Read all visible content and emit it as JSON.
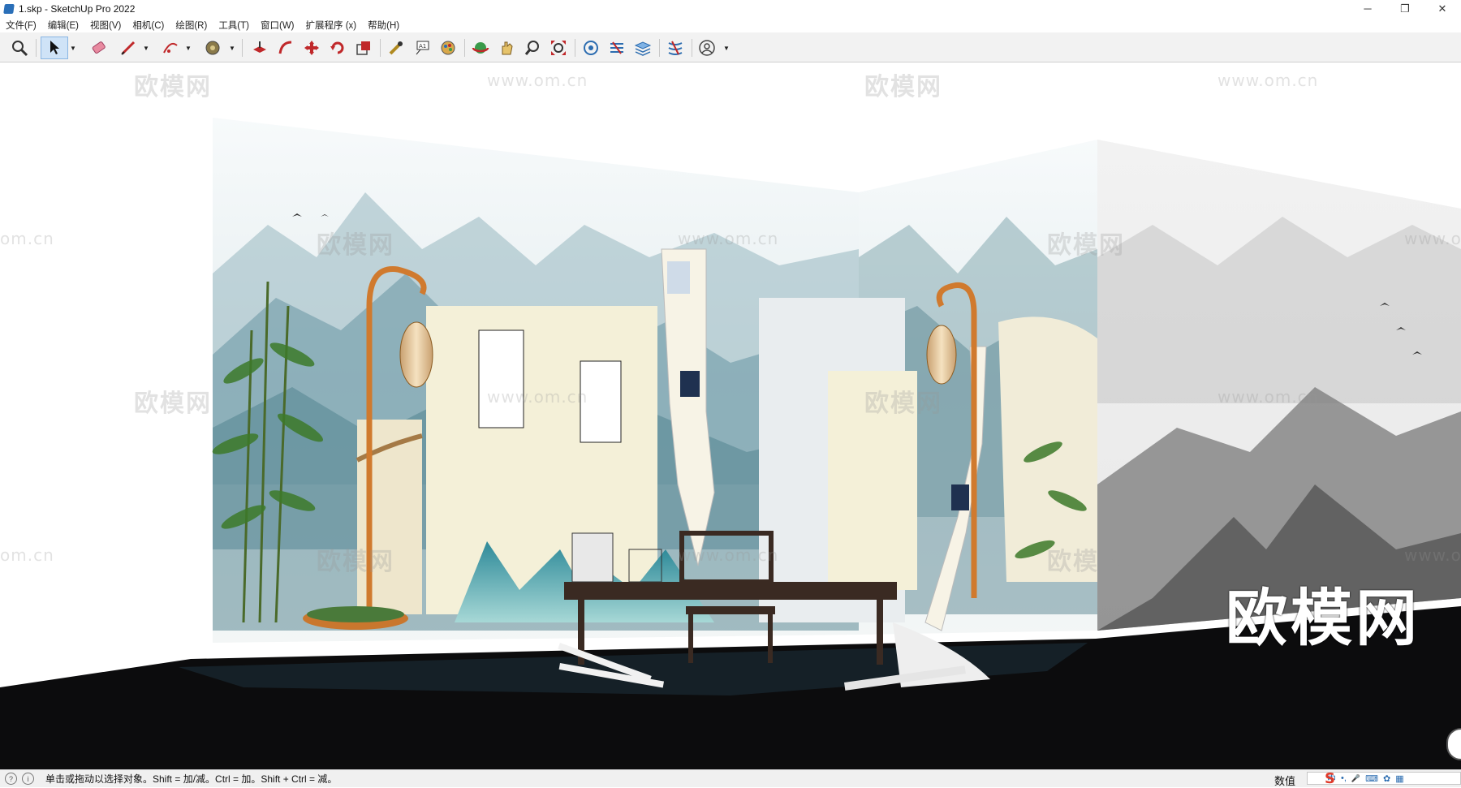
{
  "window": {
    "title": "1.skp - SketchUp Pro 2022",
    "minimize": "─",
    "restore": "❐",
    "close": "✕"
  },
  "menu": [
    "文件(F)",
    "编辑(E)",
    "视图(V)",
    "相机(C)",
    "绘图(R)",
    "工具(T)",
    "窗口(W)",
    "扩展程序 (x)",
    "帮助(H)"
  ],
  "toolbar": {
    "tools": [
      "zoom-icon",
      "select-icon",
      "eraser-icon",
      "pencil-line-icon",
      "arc-icon",
      "paint-bucket-icon",
      "push-pull-icon",
      "follow-me-icon",
      "move-icon",
      "rotate-icon",
      "scale-icon",
      "tape-measure-icon",
      "text-icon",
      "paint-icon",
      "orbit-icon",
      "pan-icon",
      "zoom-window-icon",
      "zoom-extents-icon",
      "warehouse-icon",
      "extension-icon",
      "layers-icon",
      "sandbox-icon",
      "account-icon"
    ],
    "accent": "#2b6cb0"
  },
  "watermarks": {
    "brand": "欧模网",
    "url": "www.om.cn",
    "url_fragment": "om.cn",
    "url_prefix": "www.o"
  },
  "logo": "欧模网",
  "status": {
    "message": "单击或拖动以选择对象。Shift = 加/减。Ctrl = 加。Shift + Ctrl = 减。",
    "value_label": "数值",
    "ime": [
      "中",
      "•,",
      "🎤",
      "⌨",
      "✿",
      "▦"
    ],
    "ime_logo": "S"
  },
  "colors": {
    "floor": "#0c0c0d",
    "wall_left_sky": "#e8f0f2",
    "mountain_teal": "#5e8f9c",
    "mountain_grey": "#6e6e6e",
    "lantern": "#e6c9a0",
    "lamp_pole": "#d07a2e",
    "desk": "#3a2a22",
    "screen": "#f4f0d8"
  }
}
